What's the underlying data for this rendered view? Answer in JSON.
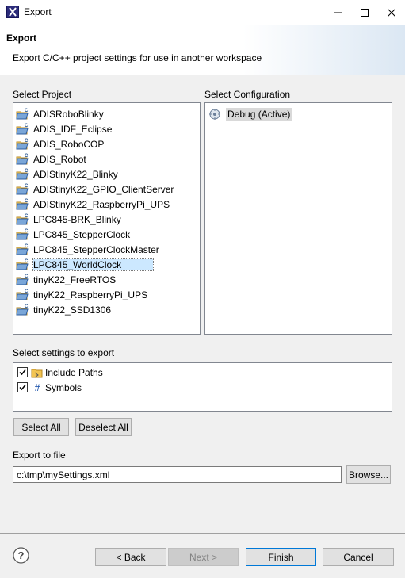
{
  "window": {
    "title": "Export"
  },
  "header": {
    "title": "Export",
    "description": "Export C/C++ project settings for use in another workspace"
  },
  "projects": {
    "label": "Select Project",
    "items": [
      "ADISRoboBlinky",
      "ADIS_IDF_Eclipse",
      "ADIS_RoboCOP",
      "ADIS_Robot",
      "ADIStinyK22_Blinky",
      "ADIStinyK22_GPIO_ClientServer",
      "ADIStinyK22_RaspberryPi_UPS",
      "LPC845-BRK_Blinky",
      "LPC845_StepperClock",
      "LPC845_StepperClockMaster",
      "LPC845_WorldClock",
      "tinyK22_FreeRTOS",
      "tinyK22_RaspberryPi_UPS",
      "tinyK22_SSD1306"
    ],
    "selected": "LPC845_WorldClock"
  },
  "configuration": {
    "label": "Select Configuration",
    "items": [
      "Debug (Active)"
    ]
  },
  "settings": {
    "label": "Select settings to export",
    "items": [
      {
        "label": "Include Paths",
        "checked": true
      },
      {
        "label": "Symbols",
        "checked": true
      }
    ],
    "select_all": "Select All",
    "deselect_all": "Deselect All"
  },
  "export_file": {
    "label": "Export to file",
    "value": "c:\\tmp\\mySettings.xml",
    "browse": "Browse..."
  },
  "footer": {
    "back": "< Back",
    "next": "Next >",
    "finish": "Finish",
    "cancel": "Cancel"
  },
  "icons": {
    "help": "help-icon",
    "project": "c-project-folder-icon",
    "config": "gear-icon",
    "include": "include-folder-icon",
    "symbols": "hash-icon"
  },
  "colors": {
    "accent": "#0078d7",
    "selection": "#cce8ff"
  }
}
